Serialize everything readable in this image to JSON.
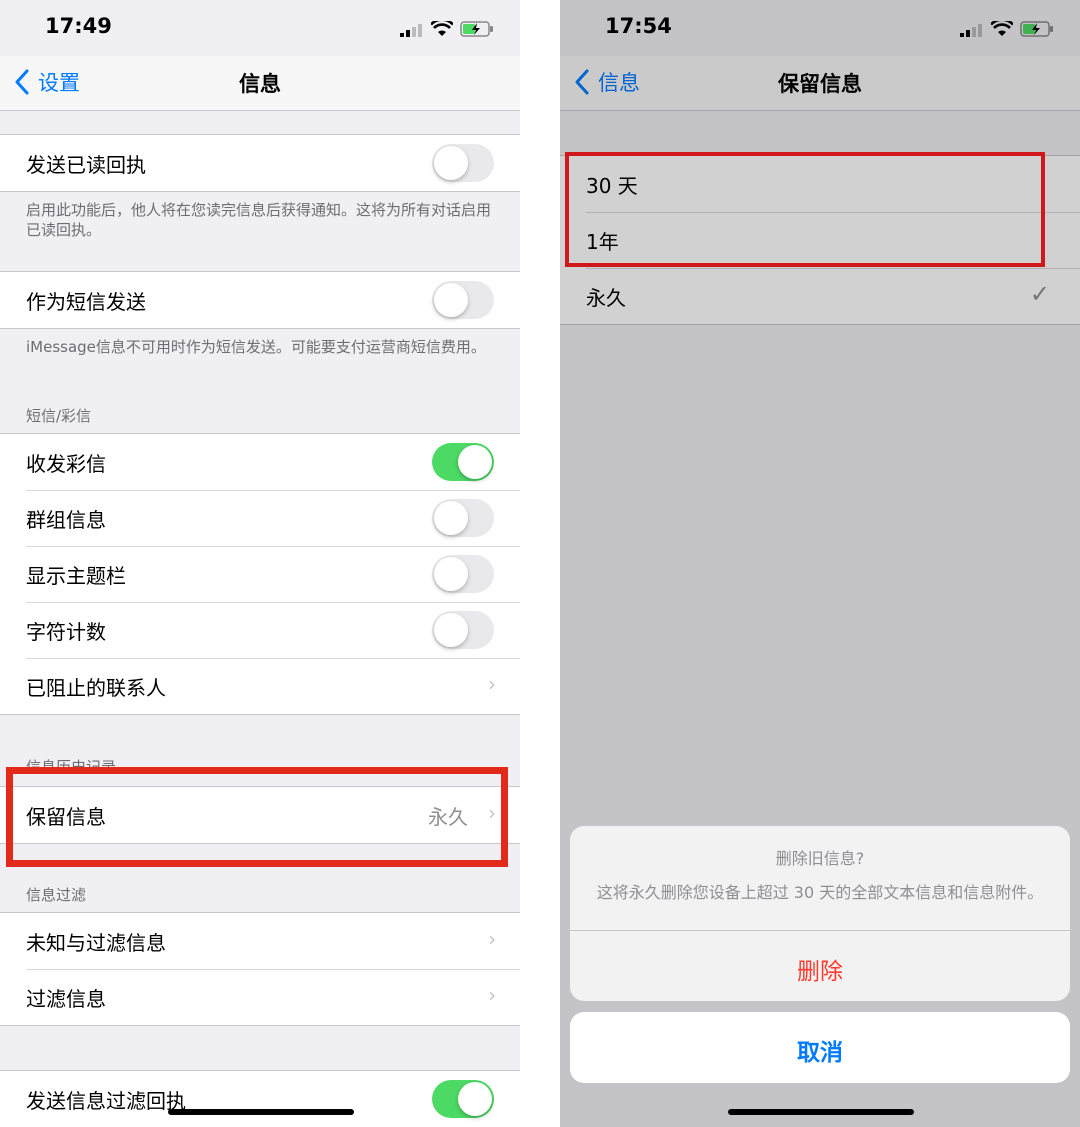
{
  "left": {
    "status": {
      "time": "17:49"
    },
    "nav": {
      "back_label": "设置",
      "title": "信息"
    },
    "rows": {
      "read_receipts": "发送已读回执",
      "read_receipts_footer": "启用此功能后，他人将在您读完信息后获得通知。这将为所有对话启用已读回执。",
      "send_as_sms": "作为短信发送",
      "send_as_sms_footer": "iMessage信息不可用时作为短信发送。可能要支付运营商短信费用。",
      "sms_header": "短信/彩信",
      "mms": "收发彩信",
      "group_messaging": "群组信息",
      "show_subject": "显示主题栏",
      "char_count": "字符计数",
      "blocked": "已阻止的联系人",
      "history_header": "信息历史记录",
      "keep_messages": "保留信息",
      "keep_messages_value": "永久",
      "filter_header": "信息过滤",
      "unknown_filter": "未知与过滤信息",
      "filter_messages": "过滤信息",
      "filter_receipts": "发送信息过滤回执"
    },
    "toggles": {
      "read_receipts": false,
      "send_as_sms": false,
      "mms": true,
      "group_messaging": false,
      "show_subject": false,
      "char_count": false,
      "filter_receipts": true
    }
  },
  "right": {
    "status": {
      "time": "17:54"
    },
    "nav": {
      "back_label": "信息",
      "title": "保留信息"
    },
    "options": [
      "30 天",
      "1年",
      "永久"
    ],
    "selected": "永久",
    "sheet": {
      "title": "删除旧信息?",
      "message": "这将永久删除您设备上超过 30 天的全部文本信息和信息附件。",
      "delete_label": "删除",
      "cancel_label": "取消"
    }
  },
  "colors": {
    "accent": "#007aff",
    "toggle_on": "#4cd964",
    "destructive": "#ff3b30",
    "highlight": "#e32a1a"
  }
}
